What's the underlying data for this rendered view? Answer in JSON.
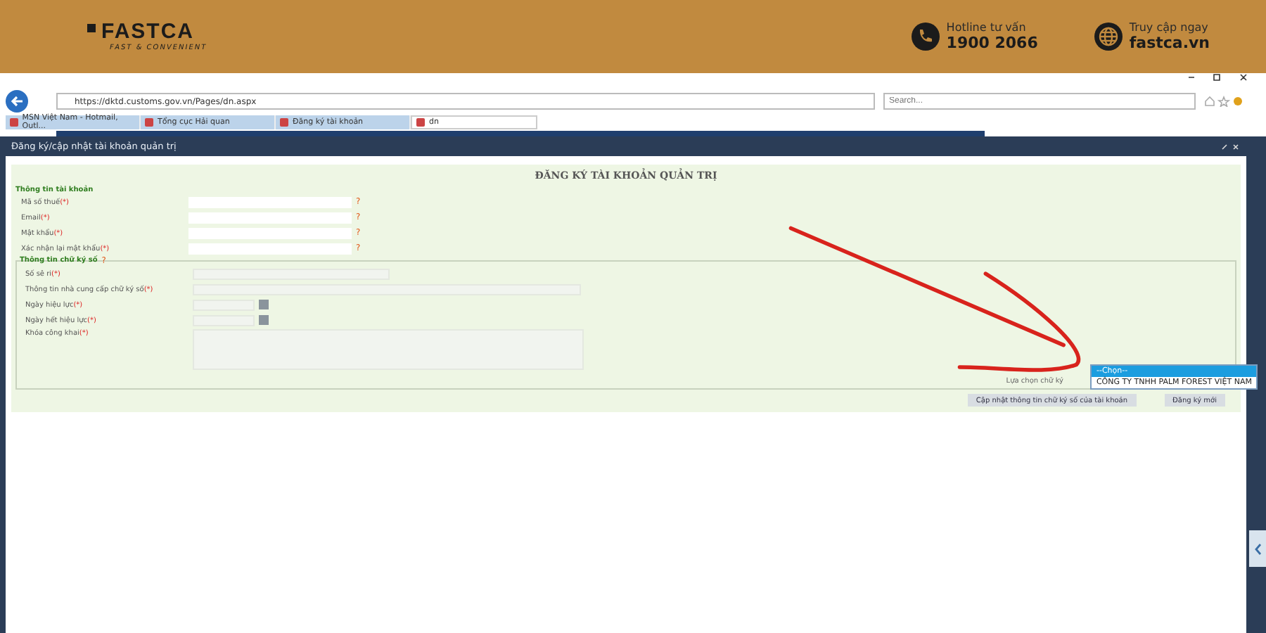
{
  "banner": {
    "logo": "FASTCA",
    "tagline": "FAST & CONVENIENT",
    "contacts": [
      {
        "kind": "phone",
        "label": "Hotline tư vấn",
        "value": "1900 2066"
      },
      {
        "kind": "web",
        "label": "Truy cập ngay",
        "value": "fastca.vn"
      }
    ]
  },
  "browser": {
    "url": "https://dktd.customs.gov.vn/Pages/dn.aspx",
    "search": {
      "placeholder": "Search..."
    },
    "tabs": [
      {
        "label": "MSN Việt Nam - Hotmail, Outl...",
        "selected": false
      },
      {
        "label": "Tổng cục Hải quan",
        "selected": false
      },
      {
        "label": "Đăng ký tài khoản",
        "selected": false
      },
      {
        "label": "dn",
        "selected": true
      }
    ]
  },
  "dialog": {
    "title": "Đăng ký/cập nhật tài khoản quản trị",
    "heading": "ĐĂNG KÝ TÀI KHOẢN QUẢN TRỊ",
    "account_section": {
      "title": "Thông tin tài khoản",
      "fields": [
        {
          "label": "Mã số thuế",
          "required": "(*)",
          "hint": "?"
        },
        {
          "label": "Email",
          "required": "(*)",
          "hint": "?"
        },
        {
          "label": "Mật khẩu",
          "required": "(*)",
          "hint": "?"
        },
        {
          "label": "Xác nhận lại mật khẩu",
          "required": "(*)",
          "hint": "?"
        }
      ]
    },
    "signature_section": {
      "title": "Thông tin chữ ký số",
      "hint": "?",
      "fields": [
        {
          "kind": "short",
          "label": "Số sê ri",
          "required": "(*)"
        },
        {
          "kind": "wide",
          "label": "Thông tin nhà cung cấp chữ ký số",
          "required": "(*)"
        },
        {
          "kind": "date",
          "label": "Ngày hiệu lực",
          "required": "(*)"
        },
        {
          "kind": "date",
          "label": "Ngày hết hiệu lực",
          "required": "(*)"
        },
        {
          "kind": "textarea",
          "label": "Khóa công khai",
          "required": "(*)"
        }
      ]
    },
    "select": {
      "label": "Lựa chọn chữ ký",
      "options": [
        {
          "label": "--Chọn--",
          "selected": true
        },
        {
          "label": "CÔNG TY TNHH PALM FOREST VIỆT NAM",
          "selected": false
        }
      ]
    },
    "buttons": [
      "Cập nhật thông tin chữ ký số của tài khoản",
      "Đăng ký mới"
    ]
  }
}
